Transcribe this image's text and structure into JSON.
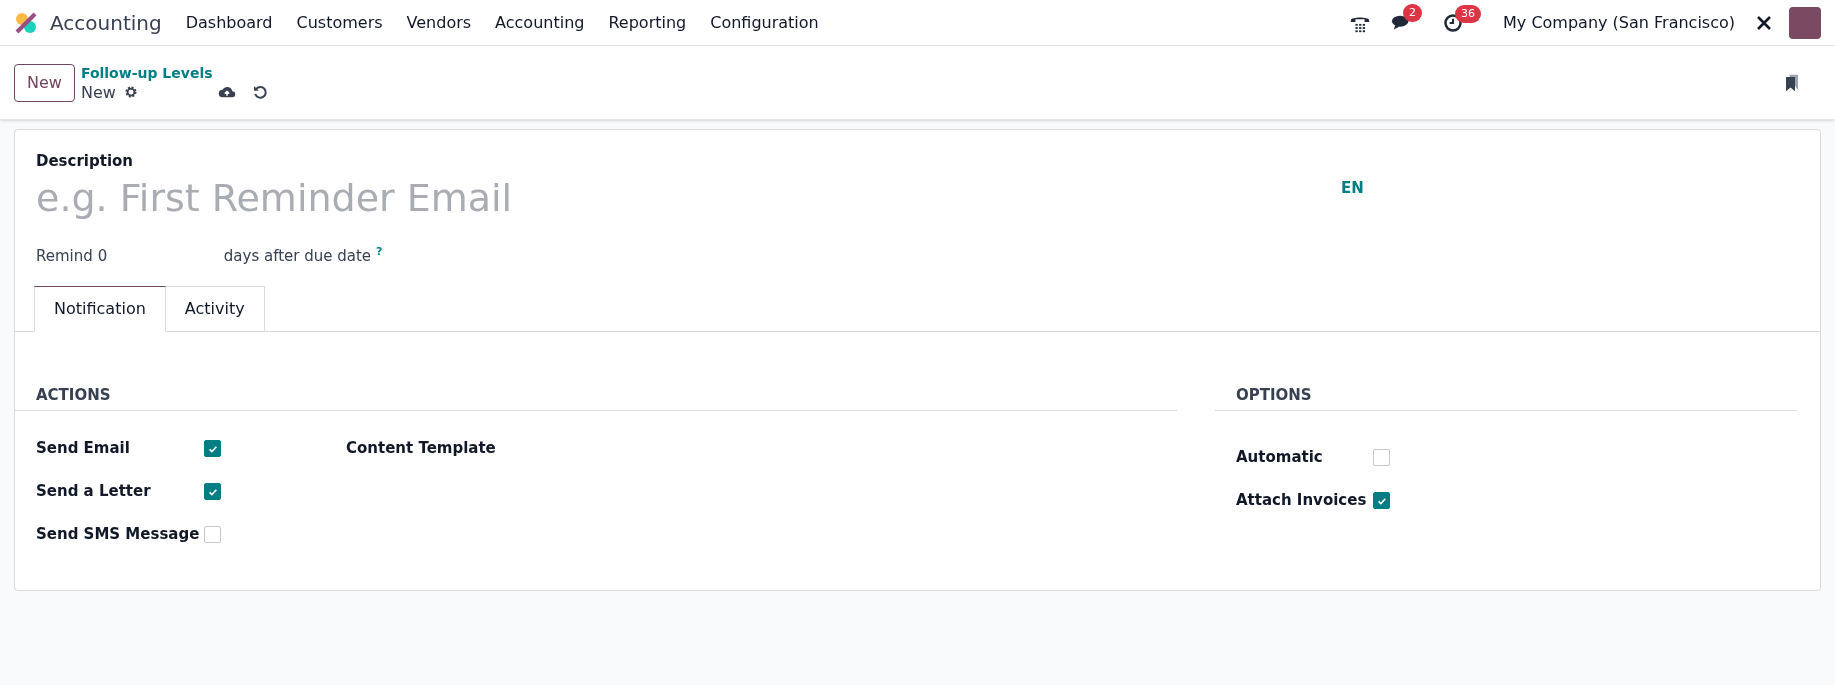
{
  "navbar": {
    "app_name": "Accounting",
    "menu": [
      "Dashboard",
      "Customers",
      "Vendors",
      "Accounting",
      "Reporting",
      "Configuration"
    ],
    "chat_badge": "2",
    "activity_badge": "36",
    "company": "My Company (San Francisco)"
  },
  "control_panel": {
    "new_button": "New",
    "breadcrumb": "Follow-up Levels",
    "record": "New"
  },
  "form": {
    "description_label": "Description",
    "description_placeholder": "e.g. First Reminder Email",
    "language": "EN",
    "remind_label": "Remind",
    "remind_value": "0",
    "remind_suffix": "days after due date",
    "help_mark": "?"
  },
  "tabs": [
    {
      "label": "Notification",
      "selected": true
    },
    {
      "label": "Activity",
      "selected": false
    }
  ],
  "actions": {
    "title": "ACTIONS",
    "fields": [
      {
        "label": "Send Email",
        "checked": true
      },
      {
        "label": "Send a Letter",
        "checked": true
      },
      {
        "label": "Send SMS Message",
        "checked": false
      }
    ],
    "content_template_label": "Content Template"
  },
  "options": {
    "title": "OPTIONS",
    "fields": [
      {
        "label": "Automatic",
        "checked": false
      },
      {
        "label": "Attach Invoices",
        "checked": true
      }
    ]
  }
}
